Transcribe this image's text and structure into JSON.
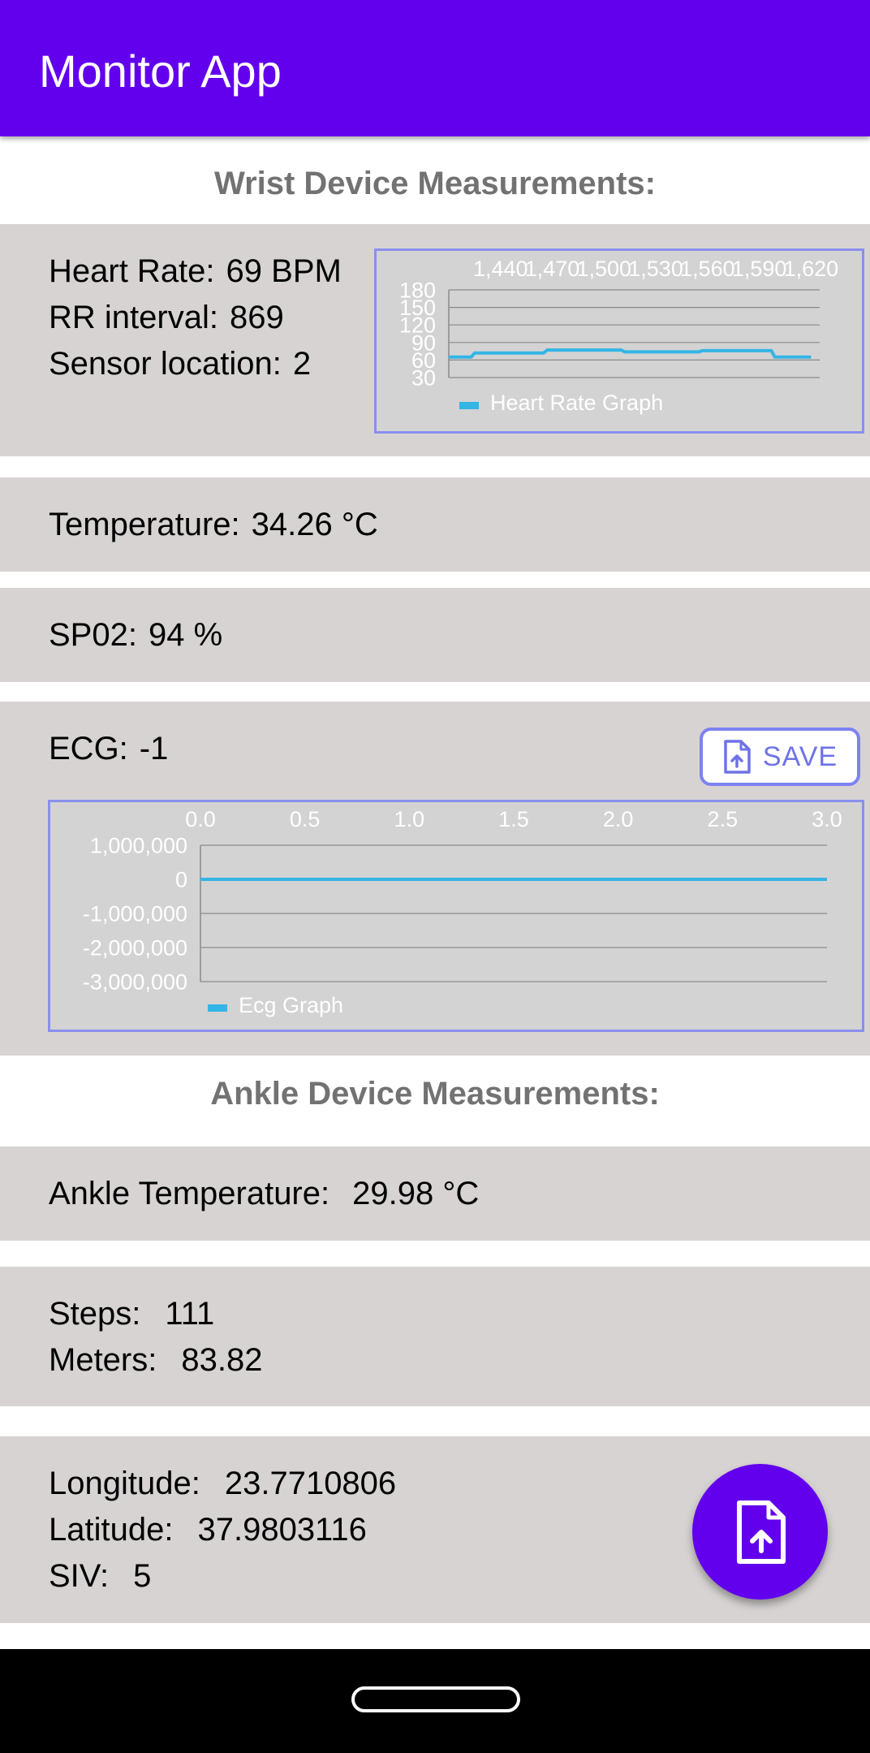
{
  "app": {
    "title": "Monitor App"
  },
  "wrist": {
    "heading": "Wrist Device Measurements:",
    "heart_rate": {
      "label": "Heart Rate:",
      "value": "69 BPM"
    },
    "rr_interval": {
      "label": "RR interval:",
      "value": "869"
    },
    "sensor_location": {
      "label": "Sensor location:",
      "value": "2"
    },
    "temperature": {
      "label": "Temperature:",
      "value": "34.26 °C"
    },
    "spo2": {
      "label": "SP02:",
      "value": "94 %"
    },
    "ecg": {
      "label": "ECG:",
      "value": "-1"
    },
    "save_button": {
      "label": "SAVE",
      "icon": "file-upload-icon"
    }
  },
  "ankle": {
    "heading": "Ankle Device Measurements:",
    "temperature": {
      "label": "Ankle Temperature:",
      "value": "29.98 °C"
    },
    "steps": {
      "label": "Steps:",
      "value": "111"
    },
    "meters": {
      "label": "Meters:",
      "value": "83.82"
    },
    "longitude": {
      "label": "Longitude:",
      "value": "23.7710806"
    },
    "latitude": {
      "label": "Latitude:",
      "value": "37.9803116"
    },
    "siv": {
      "label": "SIV:",
      "value": "5"
    }
  },
  "fab": {
    "icon": "file-upload-icon"
  },
  "colors": {
    "primary": "#6200ee",
    "card": "#d7d3d3",
    "series": "#33b5e5",
    "outline": "#8a8fee"
  },
  "chart_data": [
    {
      "type": "line",
      "legend": "Heart Rate Graph",
      "legend_position": "bottom-left",
      "x_ticks": [
        "1,440",
        "1,470",
        "1,500",
        "1,530",
        "1,560",
        "1,590",
        "1,620"
      ],
      "y_ticks": [
        "180",
        "150",
        "120",
        "90",
        "60",
        "30"
      ],
      "xlim": [
        1410,
        1625
      ],
      "ylim": [
        30,
        180
      ],
      "grid": true,
      "series": [
        {
          "name": "Heart Rate Graph",
          "x": [
            1410,
            1423,
            1425,
            1465,
            1467,
            1510,
            1512,
            1555,
            1557,
            1597,
            1599,
            1620
          ],
          "y": [
            65,
            65,
            72,
            72,
            77,
            77,
            74,
            74,
            76,
            76,
            65,
            65
          ]
        }
      ]
    },
    {
      "type": "line",
      "legend": "Ecg Graph",
      "legend_position": "bottom-left",
      "x_ticks": [
        "0.0",
        "0.5",
        "1.0",
        "1.5",
        "2.0",
        "2.5",
        "3.0"
      ],
      "y_ticks": [
        "1,000,000",
        "0",
        "-1,000,000",
        "-2,000,000",
        "-3,000,000"
      ],
      "xlim": [
        0,
        3
      ],
      "ylim": [
        -3000000,
        1000000
      ],
      "grid": true,
      "series": [
        {
          "name": "Ecg Graph",
          "x": [
            0,
            3
          ],
          "y": [
            -1,
            -1
          ]
        }
      ]
    }
  ]
}
